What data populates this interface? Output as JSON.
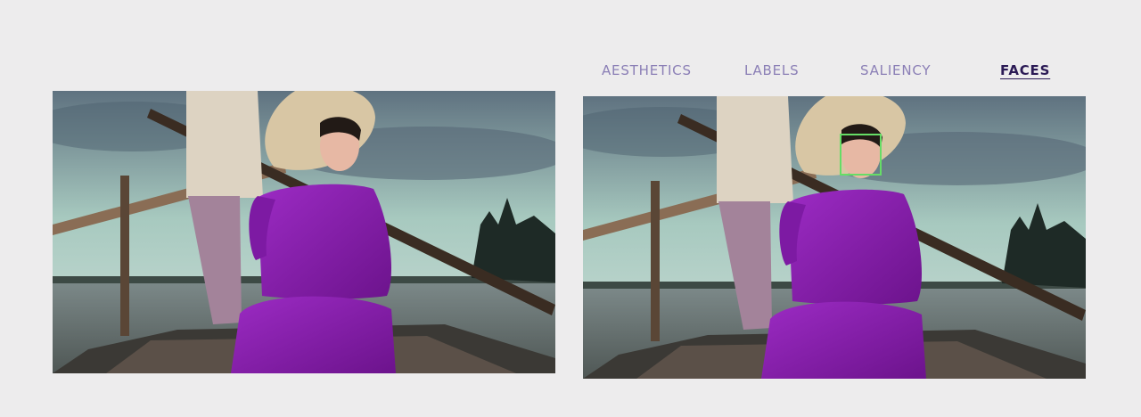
{
  "tabs": [
    {
      "label": "AESTHETICS",
      "active": false
    },
    {
      "label": "LABELS",
      "active": false
    },
    {
      "label": "SALIENCY",
      "active": false
    },
    {
      "label": "FACES",
      "active": true
    }
  ],
  "colors": {
    "background": "#edeced",
    "tab_inactive": "#8b7fb6",
    "tab_active": "#2b1a55",
    "face_box": "#66dd66",
    "dress": "#8a1fb0"
  },
  "images": {
    "original": {
      "icon": "photo-woman-boat"
    },
    "annotated": {
      "icon": "photo-woman-boat-faces",
      "faces_detected": 1
    }
  }
}
